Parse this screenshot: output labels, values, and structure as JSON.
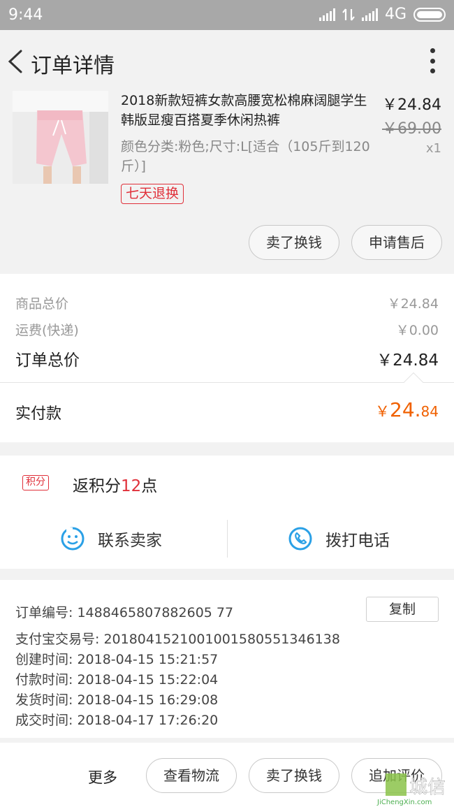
{
  "status_bar": {
    "time": "9:44",
    "network": "4G"
  },
  "nav": {
    "title": "订单详情"
  },
  "product": {
    "title": "2018新款短裤女款高腰宽松棉麻阔腿学生韩版显瘦百搭夏季休闲热裤",
    "sku": "颜色分类:粉色;尺寸:L[适合（105斤到120斤）]",
    "tag": "七天退换",
    "price": "￥24.84",
    "original_price": "￥69.00",
    "quantity": "x1",
    "buttons": [
      "卖了换钱",
      "申请售后"
    ]
  },
  "summary": {
    "goods_total_label": "商品总价",
    "goods_total": "￥24.84",
    "shipping_label": "运费(快递)",
    "shipping": "￥0.00",
    "order_total_label": "订单总价",
    "order_total": "￥24.84",
    "paid_label": "实付款",
    "paid_yen": "￥",
    "paid_int": "24.",
    "paid_dec": "84"
  },
  "points": {
    "badge": "积分",
    "text_prefix": "返积分",
    "value": "12",
    "text_suffix": "点"
  },
  "contact": {
    "seller": "联系卖家",
    "phone": "拨打电话"
  },
  "order_info": {
    "order_no_label": "订单编号:",
    "order_no": "1488465807882605 77",
    "copy_button": "复制",
    "alipay_label": "支付宝交易号:",
    "alipay_no": "2018041521001001580551346138",
    "created_label": "创建时间:",
    "created": "2018-04-15 15:21:57",
    "paid_label": "付款时间:",
    "paid": "2018-04-15 15:22:04",
    "shipped_label": "发货时间:",
    "shipped": "2018-04-15 16:29:08",
    "completed_label": "成交时间:",
    "completed": "2018-04-17 17:26:20"
  },
  "bottom_bar": {
    "more": "更多",
    "buttons": [
      "查看物流",
      "卖了换钱",
      "追加评价"
    ]
  },
  "watermark": {
    "text": "城信",
    "subtext": "JiChengXin.com"
  },
  "colors": {
    "accent_red": "#e0303a",
    "paid_orange": "#f06000",
    "icon_blue": "#2aa0e6",
    "text_gray": "#999999"
  }
}
